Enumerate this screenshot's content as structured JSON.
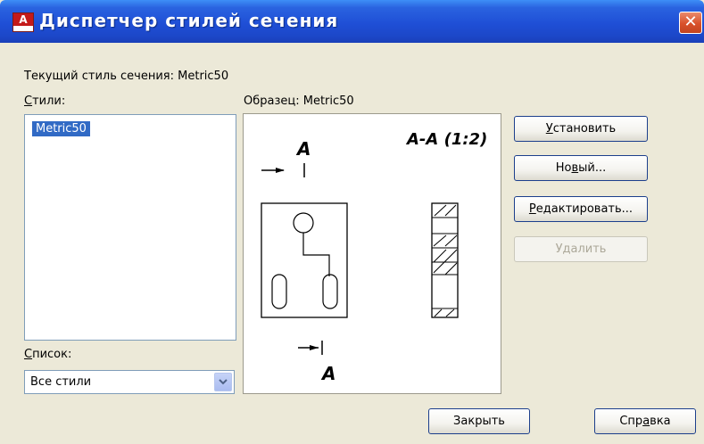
{
  "window": {
    "title": "Диспетчер стилей сечения",
    "close_glyph": "✕"
  },
  "current_style": {
    "label": "Текущий стиль сечения: Metric50"
  },
  "styles": {
    "label_underlined": "С",
    "label_rest": "тили:",
    "items": [
      "Metric50"
    ]
  },
  "list_filter": {
    "label_underlined": "С",
    "label_rest": "писок:",
    "value": "Все стили"
  },
  "preview": {
    "label": "Образец: Metric50",
    "section_title": "А-А (1:2)",
    "marker_letter_top": "А",
    "marker_letter_bottom": "А"
  },
  "buttons": {
    "set_underlined": "У",
    "set_rest": "становить",
    "new_pre": "Но",
    "new_underlined": "в",
    "new_post": "ый...",
    "edit_underlined": "Р",
    "edit_rest": "едактировать...",
    "delete_label": "Удалить",
    "close_label": "Закрыть",
    "help_pre": "Спр",
    "help_underlined": "а",
    "help_post": "вка"
  },
  "colors": {
    "titlebar": "#1f4fd6",
    "selection": "#316ac5",
    "close_button": "#d9512a",
    "dialog_bg": "#ece9d8"
  },
  "icons": [
    "autocad-app-icon",
    "close-icon",
    "dropdown-arrow-icon"
  ]
}
